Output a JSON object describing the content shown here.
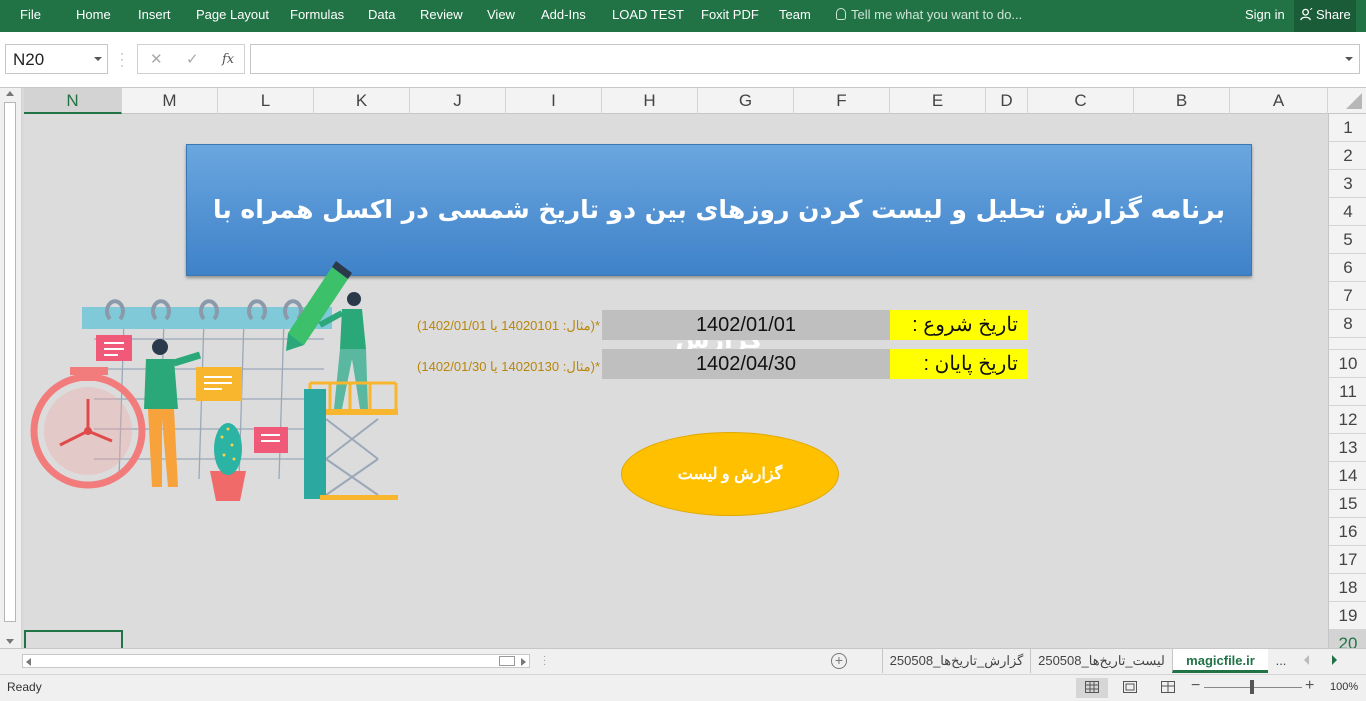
{
  "ribbon": {
    "file": "File",
    "tabs": [
      "Home",
      "Insert",
      "Page Layout",
      "Formulas",
      "Data",
      "Review",
      "View",
      "Add-Ins",
      "LOAD TEST",
      "Foxit PDF",
      "Team"
    ],
    "tell_me": "Tell me what you want to do...",
    "sign_in": "Sign in",
    "share": "Share"
  },
  "formula_bar": {
    "name_box": "N20",
    "cancel": "✕",
    "enter": "✓",
    "fx": "fx",
    "value": ""
  },
  "columns": [
    "N",
    "M",
    "L",
    "K",
    "J",
    "I",
    "H",
    "G",
    "F",
    "E",
    "D",
    "C",
    "B",
    "A"
  ],
  "selected_column": "N",
  "rows": [
    "1",
    "2",
    "3",
    "4",
    "5",
    "6",
    "7",
    "8",
    "10",
    "11",
    "12",
    "13",
    "14",
    "15",
    "16",
    "17",
    "18",
    "19",
    "20"
  ],
  "sheet": {
    "title": "برنامه گزارش تحلیل و لیست کردن روزهای بین دو تاریخ شمسی در اکسل همراه با گزارش",
    "start_label": "تاریخ شروع   :",
    "start_value": "1402/01/01",
    "start_hint": "*(مثال: 14020101 یا 1402/01/01)",
    "end_label": "تاریخ پایان    :",
    "end_value": "1402/04/30",
    "end_hint": "*(مثال: 14020130 یا 1402/01/30)",
    "report_button": "گزارش و لیست"
  },
  "sheet_tabs": {
    "overflow": "...",
    "tabs": [
      "magicfile.ir",
      "لیست_تاریخ‌ها_250508",
      "گزارش_تاریخ‌ها_250508"
    ],
    "active": "magicfile.ir"
  },
  "status": {
    "ready": "Ready",
    "zoom": "100%"
  },
  "colors": {
    "accent": "#217346",
    "banner": "#4a8fd4",
    "label_bg": "#ffff00",
    "button": "#ffc000"
  }
}
